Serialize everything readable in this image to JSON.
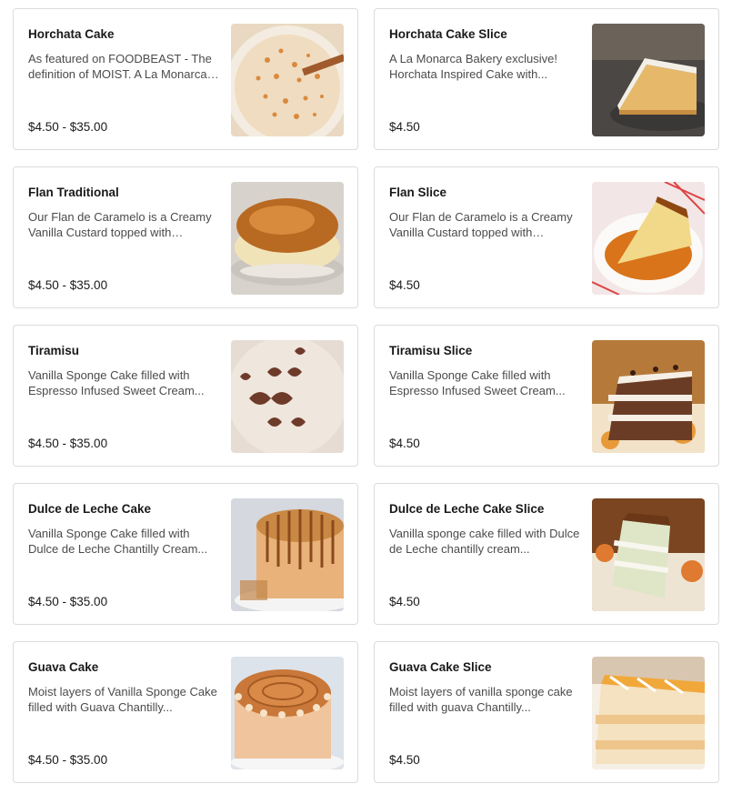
{
  "menu": {
    "items": [
      {
        "title": "Horchata Cake",
        "description": "As featured on FOODBEAST - The definition of MOIST. A La Monarca exclusive...",
        "price": "$4.50 - $35.00",
        "image": "horchata-cake-photo"
      },
      {
        "title": "Horchata Cake Slice",
        "description": "A La Monarca Bakery exclusive! Horchata Inspired Cake with...",
        "price": "$4.50",
        "image": "horchata-cake-slice-photo"
      },
      {
        "title": "Flan Traditional",
        "description": "Our Flan de Caramelo is a Creamy Vanilla Custard topped with caramel...",
        "price": "$4.50 - $35.00",
        "image": "flan-traditional-photo"
      },
      {
        "title": "Flan Slice",
        "description": "Our Flan de Caramelo is a Creamy Vanilla Custard topped with caramel...",
        "price": "$4.50",
        "image": "flan-slice-photo"
      },
      {
        "title": "Tiramisu",
        "description": "Vanilla Sponge Cake filled with Espresso Infused Sweet Cream...",
        "price": "$4.50 - $35.00",
        "image": "tiramisu-photo"
      },
      {
        "title": "Tiramisu Slice",
        "description": "Vanilla Sponge Cake filled with Espresso Infused Sweet Cream...",
        "price": "$4.50",
        "image": "tiramisu-slice-photo"
      },
      {
        "title": "Dulce de Leche Cake",
        "description": "Vanilla Sponge Cake filled with Dulce de Leche Chantilly Cream...",
        "price": "$4.50 - $35.00",
        "image": "dulce-de-leche-cake-photo"
      },
      {
        "title": "Dulce de Leche Cake Slice",
        "description": "Vanilla sponge cake filled with Dulce de Leche chantilly cream...",
        "price": "$4.50",
        "image": "dulce-de-leche-slice-photo"
      },
      {
        "title": "Guava Cake",
        "description": "Moist layers of Vanilla Sponge Cake filled with Guava Chantilly...",
        "price": "$4.50 - $35.00",
        "image": "guava-cake-photo"
      },
      {
        "title": "Guava Cake Slice",
        "description": "Moist layers of vanilla sponge cake filled with guava Chantilly...",
        "price": "$4.50",
        "image": "guava-cake-slice-photo"
      }
    ]
  }
}
